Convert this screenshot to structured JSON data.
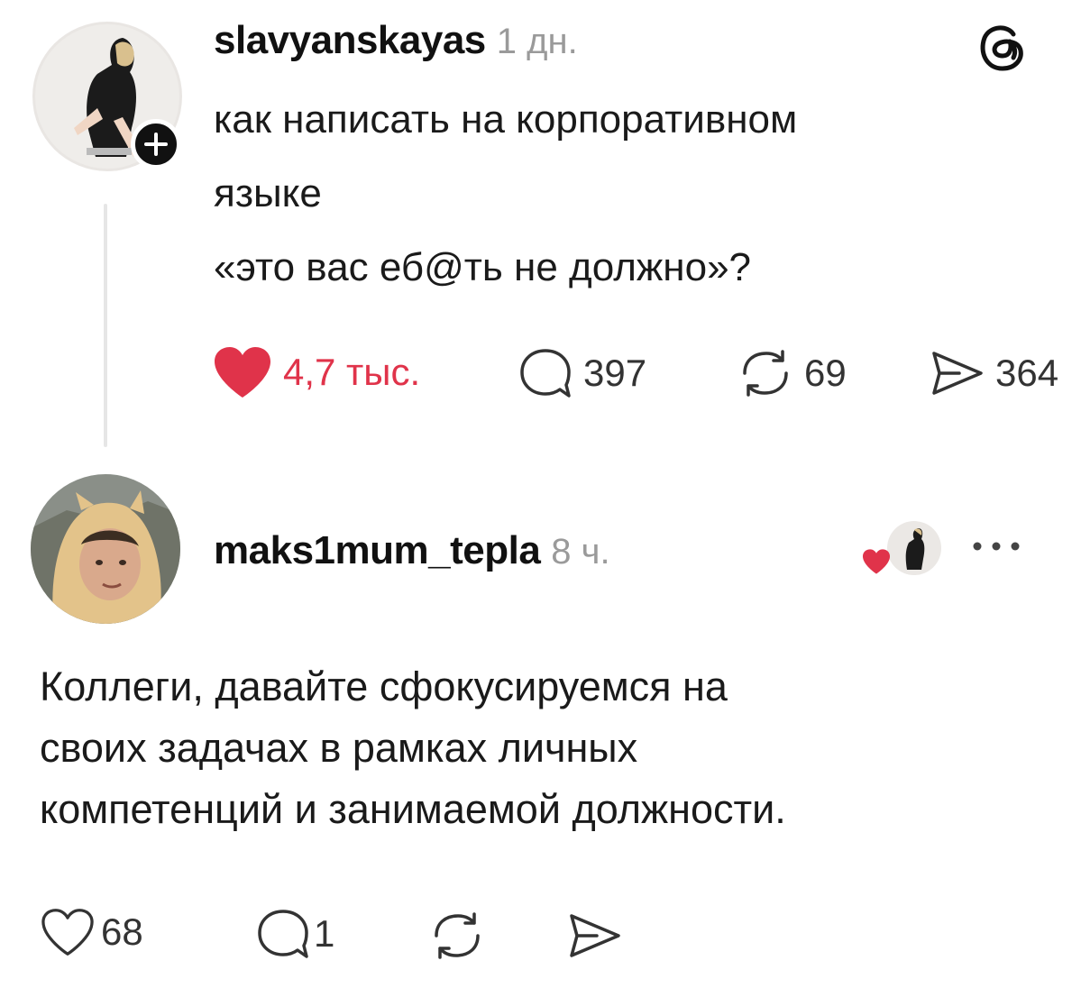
{
  "post": {
    "username": "slavyanskayas",
    "time": "1 дн.",
    "text": "как написать на корпоративном\nязыке\n«это вас еб@ть не должно»?",
    "likes": "4,7 тыс.",
    "replies": "397",
    "reposts": "69",
    "shares": "364",
    "liked": true,
    "icons": {
      "avatar": "avatar-photo",
      "follow": "plus-icon",
      "app": "threads-logo-icon",
      "like": "heart-filled-icon",
      "reply": "comment-bubble-icon",
      "repost": "repost-icon",
      "share": "send-icon"
    }
  },
  "reply": {
    "username": "maks1mum_tepla",
    "time": "8 ч.",
    "text": "Коллеги, давайте сфокусируемся на\nсвоих задачах в рамках личных\nкомпетенций и занимаемой должности.",
    "likes": "68",
    "replies": "1",
    "icons": {
      "avatar": "avatar-photo",
      "liked_by_author": "liked-by-author-badge",
      "more": "more-dots-icon",
      "like": "heart-outline-icon",
      "reply": "comment-bubble-icon",
      "repost": "repost-icon",
      "share": "send-icon"
    }
  },
  "colors": {
    "heart": "#e0334a",
    "muted": "#9a9a9a",
    "text": "#1a1a1a"
  }
}
